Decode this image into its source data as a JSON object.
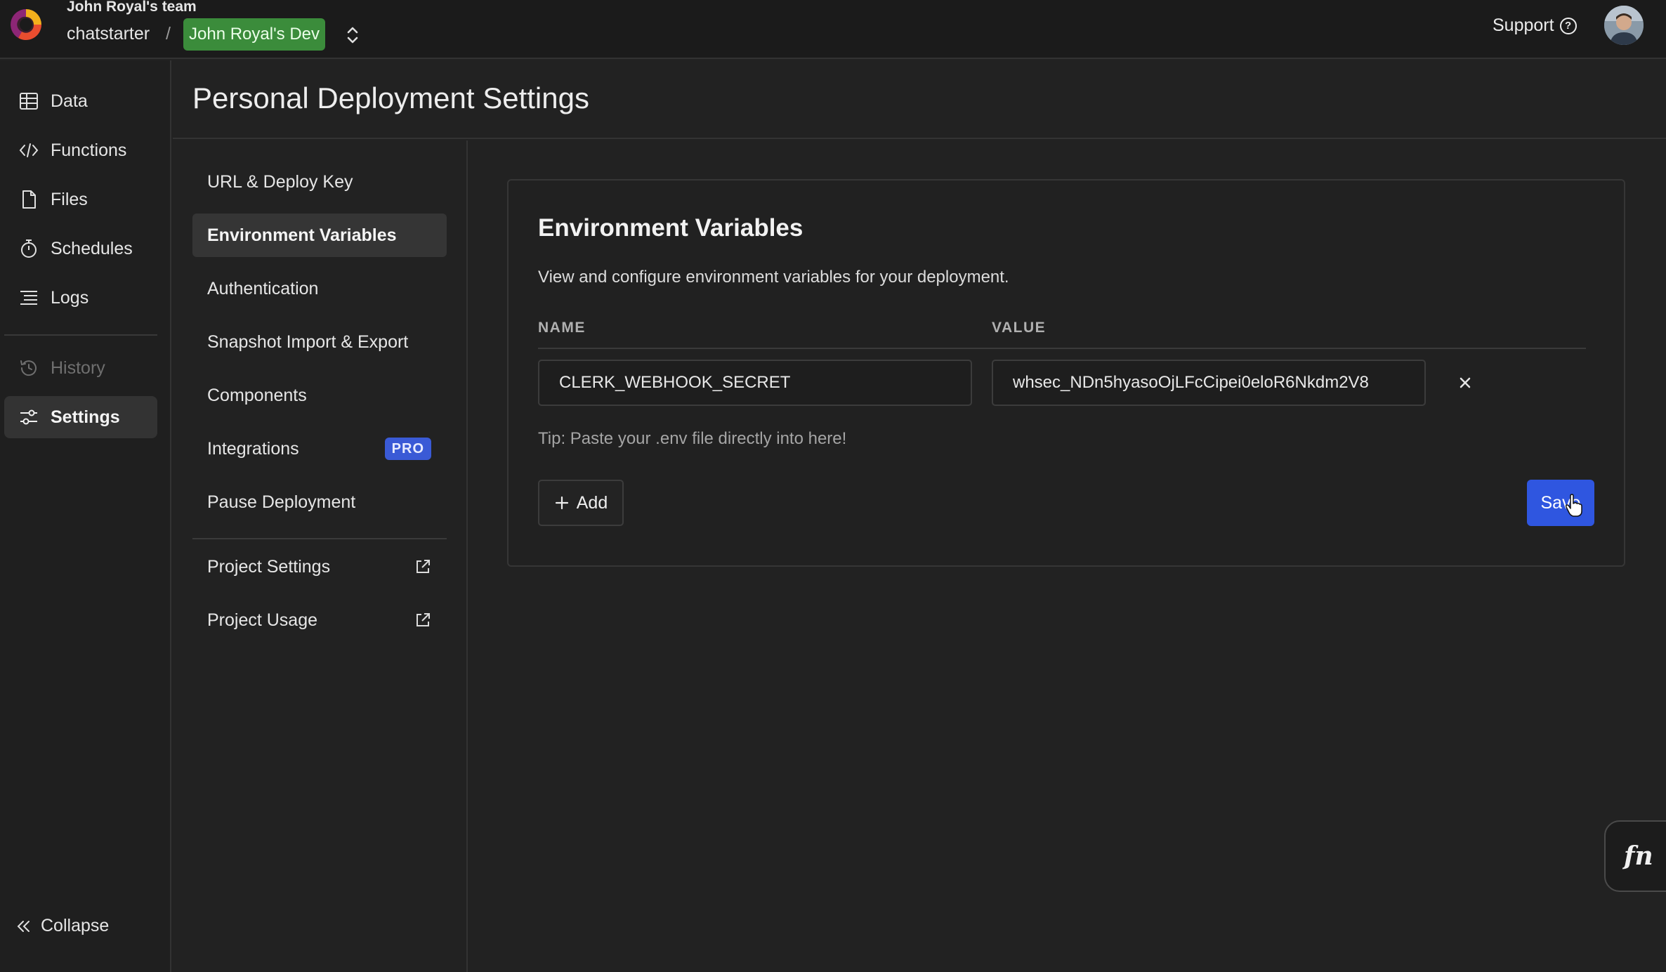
{
  "topbar": {
    "team": "John Royal's team",
    "project": "chatstarter",
    "separator": "/",
    "deployment": "John Royal's Dev",
    "support_label": "Support",
    "colors": {
      "deployment_badge": "#3b8c3b"
    }
  },
  "sidebar": {
    "items": [
      {
        "label": "Data",
        "icon": "table-icon"
      },
      {
        "label": "Functions",
        "icon": "code-icon"
      },
      {
        "label": "Files",
        "icon": "file-icon"
      },
      {
        "label": "Schedules",
        "icon": "stopwatch-icon"
      },
      {
        "label": "Logs",
        "icon": "list-icon"
      },
      {
        "label": "History",
        "icon": "history-icon",
        "disabled": true
      },
      {
        "label": "Settings",
        "icon": "sliders-icon",
        "active": true
      }
    ],
    "collapse_label": "Collapse"
  },
  "page": {
    "title": "Personal Deployment Settings"
  },
  "settings_nav": {
    "items": [
      {
        "label": "URL & Deploy Key"
      },
      {
        "label": "Environment Variables",
        "active": true
      },
      {
        "label": "Authentication"
      },
      {
        "label": "Snapshot Import & Export"
      },
      {
        "label": "Components"
      },
      {
        "label": "Integrations",
        "badge": "PRO"
      },
      {
        "label": "Pause Deployment"
      },
      {
        "label": "Project Settings",
        "icon": "external-link-icon"
      },
      {
        "label": "Project Usage",
        "icon": "external-link-icon"
      }
    ]
  },
  "env_card": {
    "title": "Environment Variables",
    "description": "View and configure environment variables for your deployment.",
    "col_name": "NAME",
    "col_value": "VALUE",
    "rows": [
      {
        "name": "CLERK_WEBHOOK_SECRET",
        "value": "whsec_NDn5hyasoOjLFcCipei0eloR6Nkdm2V8"
      }
    ],
    "tip": "Tip: Paste your .env file directly into here!",
    "add_label": "Add",
    "save_label": "Save",
    "colors": {
      "save_button": "#2f56e0",
      "pro_badge": "#3a5ad6"
    }
  },
  "fn_button": {
    "label": "fn"
  }
}
